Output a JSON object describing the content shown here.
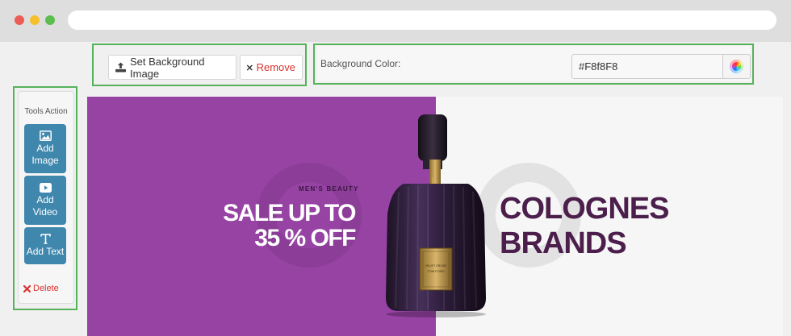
{
  "toolbar": {
    "set_bg_label": "Set Background Image",
    "remove_label": "Remove"
  },
  "background": {
    "label": "Background Color:",
    "value": "#F8f8F8"
  },
  "tools": {
    "title": "Tools Action",
    "add_image_label": "Add Image",
    "add_video_label": "Add Video",
    "add_text_label": "Add Text",
    "delete_label": "Delete"
  },
  "banner": {
    "kicker": "MEN'S BEAUTY",
    "sale_line1": "SALE UP TO",
    "sale_line2": "35 % OFF",
    "brand_line1": "COLOGNES",
    "brand_line2": "BRANDS",
    "bottle_label_line1": "VELVET ORCHID",
    "bottle_label_line2": "TOM FORD"
  },
  "colors": {
    "accent_blue": "#3f87ad",
    "banner_purple": "#9743a4",
    "highlight_green": "#56b25a",
    "danger_red": "#d9322f"
  }
}
